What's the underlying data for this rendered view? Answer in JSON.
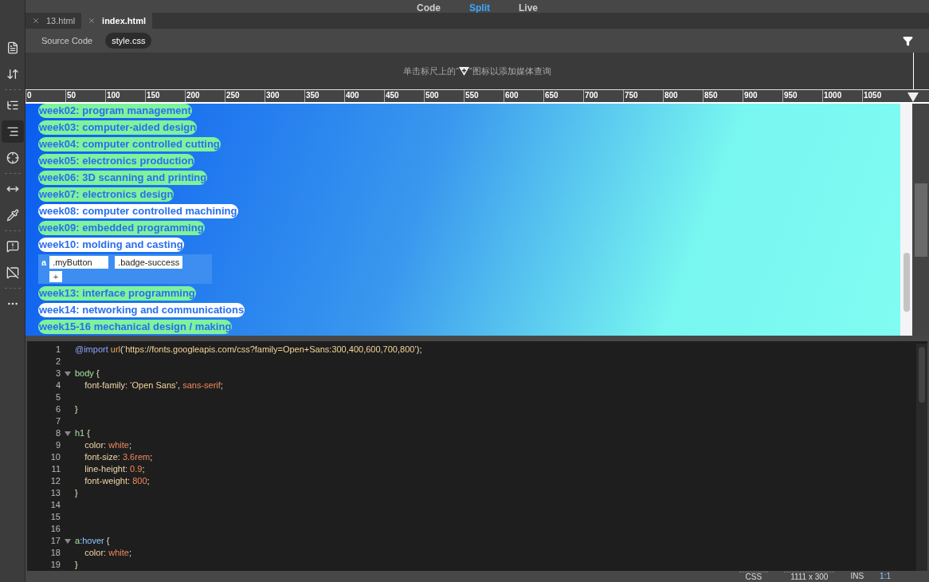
{
  "view_switcher": [
    {
      "label": "Code",
      "selected": false
    },
    {
      "label": "Split",
      "selected": true
    },
    {
      "label": "Live",
      "selected": false
    }
  ],
  "document_tabs": [
    {
      "label": "13.html",
      "selected": false
    },
    {
      "label": "index.html",
      "selected": true
    }
  ],
  "related_files": [
    {
      "label": "Source Code",
      "selected": false
    },
    {
      "label": "style.css",
      "selected": true
    }
  ],
  "media_query_hint": {
    "before": "单击标尺上的“",
    "after": "”图标以添加媒体查询"
  },
  "ruler": [
    "0",
    "50",
    "100",
    "150",
    "200",
    "250",
    "300",
    "350",
    "400",
    "450",
    "500",
    "550",
    "600",
    "650",
    "700",
    "750",
    "800",
    "850",
    "900",
    "950",
    "1000",
    "1050"
  ],
  "preview": {
    "links": [
      {
        "label": "week02: program management",
        "color": "#7ef29c"
      },
      {
        "label": "week03: computer-aided design",
        "color": "#7ef29c"
      },
      {
        "label": "week04: computer controlled cutting",
        "color": "#7ef29c"
      },
      {
        "label": "week05: electronics production",
        "color": "#7ef29c"
      },
      {
        "label": "week06: 3D scanning and printing",
        "color": "#7ef29c"
      },
      {
        "label": "week07: electronics design",
        "color": "#7ef29c"
      },
      {
        "label": "week08: computer controlled machining",
        "color": "#ffffff"
      },
      {
        "label": "week09: embedded programming",
        "color": "#7ef29c"
      },
      {
        "label": "week10: molding and casting",
        "color": "#ffffff"
      },
      {
        "kind": "popup",
        "tag": "a",
        "classes": [
          ".myButton",
          ".badge-success"
        ],
        "add": "+"
      },
      {
        "label": "week13: interface programming",
        "color": "#7ef29c"
      },
      {
        "label": "week14: networking and communications",
        "color": "#ffffff"
      },
      {
        "label": "week15-16 mechanical design / making",
        "color": "#7ef29c"
      }
    ]
  },
  "code_lines": [
    {
      "number": "1",
      "foldable": false,
      "tokens": [
        {
          "kind": "at",
          "text": "@import"
        },
        {
          "kind": "fn",
          "text": " url"
        },
        {
          "kind": "punct",
          "text": "("
        },
        {
          "kind": "str",
          "text": "‘https://fonts.googleapis.com/css?family=Open+Sans:300,400,600,700,800’"
        },
        {
          "kind": "punct",
          "text": ");"
        }
      ]
    },
    {
      "number": "2",
      "foldable": false
    },
    {
      "number": "3",
      "foldable": true,
      "tokens": [
        {
          "kind": "sel",
          "text": "body"
        },
        {
          "kind": "punct",
          "text": " {"
        }
      ]
    },
    {
      "number": "4",
      "foldable": false,
      "tokens": [
        {
          "kind": "prop",
          "text": "    font-family: "
        },
        {
          "kind": "str",
          "text": "‘Open Sans’"
        },
        {
          "kind": "punct",
          "text": ", "
        },
        {
          "kind": "val",
          "text": "sans-serif"
        },
        {
          "kind": "punct",
          "text": ";"
        }
      ]
    },
    {
      "number": "5",
      "foldable": false
    },
    {
      "number": "6",
      "foldable": false,
      "tokens": [
        {
          "kind": "punct",
          "text": "}"
        }
      ]
    },
    {
      "number": "7",
      "foldable": false
    },
    {
      "number": "8",
      "foldable": true,
      "tokens": [
        {
          "kind": "sel",
          "text": "h1"
        },
        {
          "kind": "punct",
          "text": " {"
        }
      ]
    },
    {
      "number": "9",
      "foldable": false,
      "tokens": [
        {
          "kind": "prop",
          "text": "    color: "
        },
        {
          "kind": "val",
          "text": "white"
        },
        {
          "kind": "punct",
          "text": ";"
        }
      ]
    },
    {
      "number": "10",
      "foldable": false,
      "tokens": [
        {
          "kind": "prop",
          "text": "    font-size: "
        },
        {
          "kind": "val",
          "text": "3.6rem"
        },
        {
          "kind": "punct",
          "text": ";"
        }
      ]
    },
    {
      "number": "11",
      "foldable": false,
      "tokens": [
        {
          "kind": "prop",
          "text": "    line-height: "
        },
        {
          "kind": "val",
          "text": "0.9"
        },
        {
          "kind": "punct",
          "text": ";"
        }
      ]
    },
    {
      "number": "12",
      "foldable": false,
      "tokens": [
        {
          "kind": "prop",
          "text": "    font-weight: "
        },
        {
          "kind": "val",
          "text": "800"
        },
        {
          "kind": "punct",
          "text": ";"
        }
      ]
    },
    {
      "number": "13",
      "foldable": false,
      "tokens": [
        {
          "kind": "punct",
          "text": "}"
        }
      ]
    },
    {
      "number": "14",
      "foldable": false
    },
    {
      "number": "15",
      "foldable": false
    },
    {
      "number": "16",
      "foldable": false
    },
    {
      "number": "17",
      "foldable": true,
      "tokens": [
        {
          "kind": "sel",
          "text": "a"
        },
        {
          "kind": "pseudo",
          "text": ":hover"
        },
        {
          "kind": "punct",
          "text": " {"
        }
      ]
    },
    {
      "number": "18",
      "foldable": false,
      "tokens": [
        {
          "kind": "prop",
          "text": "    color: "
        },
        {
          "kind": "val",
          "text": "white"
        },
        {
          "kind": "punct",
          "text": ";"
        }
      ]
    },
    {
      "number": "19",
      "foldable": false,
      "tokens": [
        {
          "kind": "punct",
          "text": "}"
        }
      ]
    }
  ],
  "status_bar": {
    "language": "CSS",
    "size": "1111 x 300",
    "mode": "INS",
    "position": "1:1"
  }
}
